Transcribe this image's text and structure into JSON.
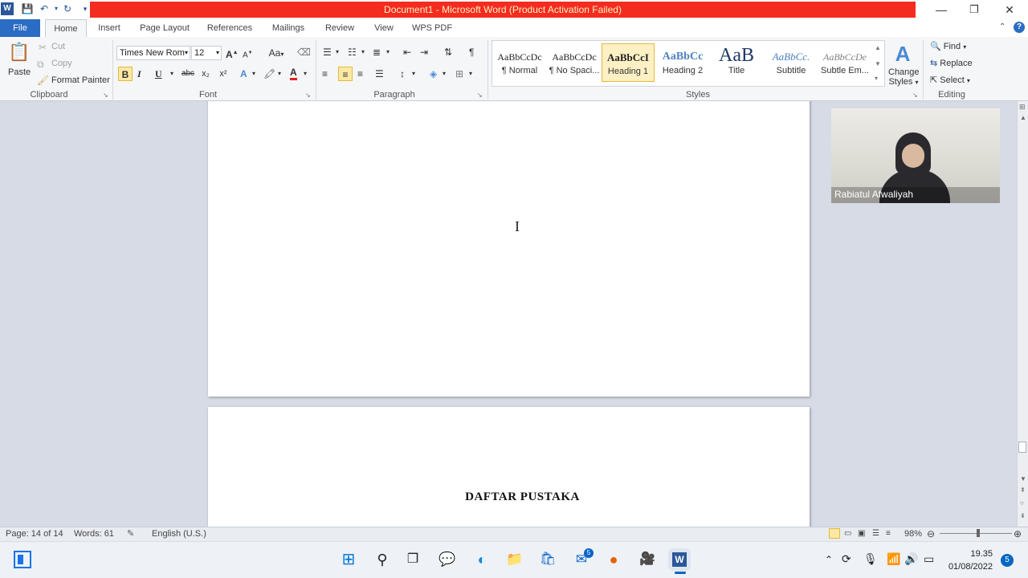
{
  "window": {
    "title": "Document1  -  Microsoft Word (Product Activation Failed)",
    "title_bar_color": "#f42b1f",
    "controls": [
      "minimize-icon",
      "restore-icon",
      "close-icon"
    ]
  },
  "tabs": [
    "File",
    "Home",
    "Insert",
    "Page Layout",
    "References",
    "Mailings",
    "Review",
    "View",
    "WPS PDF"
  ],
  "active_tab": "Home",
  "ribbon": {
    "clipboard": {
      "label": "Clipboard",
      "paste": "Paste",
      "cut": "Cut",
      "copy": "Copy",
      "format_painter": "Format Painter"
    },
    "font": {
      "label": "Font",
      "font_name": "Times New Rom",
      "font_size": "12",
      "change_case": "Aa",
      "bold": "B",
      "italic": "I",
      "underline": "U",
      "strike": "abc",
      "subscript": "x₂",
      "superscript": "x²"
    },
    "paragraph": {
      "label": "Paragraph",
      "alignment": "center"
    },
    "styles": {
      "label": "Styles",
      "items": [
        {
          "sample": "AaBbCcDc",
          "name": "¶ Normal"
        },
        {
          "sample": "AaBbCcDc",
          "name": "¶ No Spaci..."
        },
        {
          "sample": "AaBbCcI",
          "name": "Heading 1"
        },
        {
          "sample": "AaBbCc",
          "name": "Heading 2"
        },
        {
          "sample": "AaB",
          "name": "Title"
        },
        {
          "sample": "AaBbCc.",
          "name": "Subtitle"
        },
        {
          "sample": "AaBbCcDe",
          "name": "Subtle Em..."
        }
      ],
      "selected": "Heading 1",
      "change_styles_line1": "Change",
      "change_styles_line2": "Styles"
    },
    "editing": {
      "label": "Editing",
      "find": "Find",
      "replace": "Replace",
      "select": "Select"
    }
  },
  "document": {
    "page2_heading": "DAFTAR PUSTAKA"
  },
  "video_participant": "Rabiatul Afwaliyah",
  "statusbar": {
    "page": "Page: 14 of 14",
    "words": "Words: 61",
    "language": "English (U.S.)",
    "zoom": "98%",
    "zoom_percent": 98
  },
  "taskbar": {
    "time": "19.35",
    "date": "01/08/2022",
    "mail_badge": "5",
    "notification_count": "5"
  }
}
